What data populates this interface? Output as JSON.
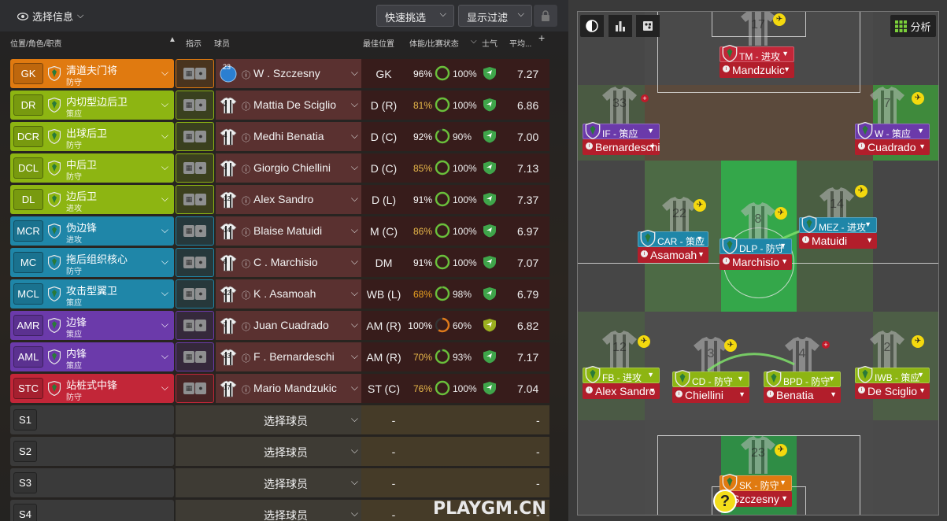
{
  "topbar": {
    "info_label": "选择信息",
    "quick_pick_label": "快速挑选",
    "filter_label": "显示过滤"
  },
  "columns": {
    "position": "位置/角色/职责",
    "instructions": "指示",
    "player": "球员",
    "best_position": "最佳位置",
    "condition": "体能/比赛状态",
    "morale": "士气",
    "average": "平均..."
  },
  "rows": [
    {
      "pos": "GK",
      "role": "清道夫门将",
      "duty": "防守",
      "color": "#e07a10",
      "player": "W . Szczesny",
      "shirt": "23",
      "best": "GK",
      "fitness": "96%",
      "fit_pct": 96,
      "fit_color": "#ffffff",
      "morale": "100%",
      "morale_pct": 100,
      "morale_color": "#6abf3a",
      "avg": "7.27"
    },
    {
      "pos": "DR",
      "role": "内切型边后卫",
      "duty": "策应",
      "color": "#8db512",
      "player": "Mattia De Sciglio",
      "shirt": "2",
      "best": "D (R)",
      "fitness": "81%",
      "fit_pct": 81,
      "fit_color": "#e8b84a",
      "morale": "100%",
      "morale_pct": 100,
      "morale_color": "#6abf3a",
      "avg": "6.86"
    },
    {
      "pos": "DCR",
      "role": "出球后卫",
      "duty": "防守",
      "color": "#8db512",
      "player": "Medhi Benatia",
      "shirt": "4",
      "best": "D (C)",
      "fitness": "92%",
      "fit_pct": 92,
      "fit_color": "#ffffff",
      "morale": "90%",
      "morale_pct": 90,
      "morale_color": "#6abf3a",
      "avg": "7.00"
    },
    {
      "pos": "DCL",
      "role": "中后卫",
      "duty": "防守",
      "color": "#8db512",
      "player": "Giorgio Chiellini",
      "shirt": "3",
      "best": "D (C)",
      "fitness": "85%",
      "fit_pct": 85,
      "fit_color": "#e8b84a",
      "morale": "100%",
      "morale_pct": 100,
      "morale_color": "#6abf3a",
      "avg": "7.13"
    },
    {
      "pos": "DL",
      "role": "边后卫",
      "duty": "进攻",
      "color": "#8db512",
      "player": "Alex Sandro",
      "shirt": "12",
      "best": "D (L)",
      "fitness": "91%",
      "fit_pct": 91,
      "fit_color": "#ffffff",
      "morale": "100%",
      "morale_pct": 100,
      "morale_color": "#6abf3a",
      "avg": "7.37"
    },
    {
      "pos": "MCR",
      "role": "伪边锋",
      "duty": "进攻",
      "color": "#1f86a8",
      "player": "Blaise Matuidi",
      "shirt": "14",
      "best": "M (C)",
      "fitness": "86%",
      "fit_pct": 86,
      "fit_color": "#e8b84a",
      "morale": "100%",
      "morale_pct": 100,
      "morale_color": "#6abf3a",
      "avg": "6.97"
    },
    {
      "pos": "MC",
      "role": "拖后组织核心",
      "duty": "防守",
      "color": "#1f86a8",
      "player": "C . Marchisio",
      "shirt": "8",
      "best": "DM",
      "fitness": "91%",
      "fit_pct": 91,
      "fit_color": "#ffffff",
      "morale": "100%",
      "morale_pct": 100,
      "morale_color": "#6abf3a",
      "avg": "7.07"
    },
    {
      "pos": "MCL",
      "role": "攻击型翼卫",
      "duty": "策应",
      "color": "#1f86a8",
      "player": "K . Asamoah",
      "shirt": "22",
      "best": "WB (L)",
      "fitness": "68%",
      "fit_pct": 68,
      "fit_color": "#e8a020",
      "morale": "98%",
      "morale_pct": 98,
      "morale_color": "#6abf3a",
      "avg": "6.79"
    },
    {
      "pos": "AMR",
      "role": "边锋",
      "duty": "策应",
      "color": "#6b3aaa",
      "player": "Juan Cuadrado",
      "shirt": "7",
      "best": "AM (R)",
      "fitness": "100%",
      "fit_pct": 100,
      "fit_color": "#ffffff",
      "morale": "60%",
      "morale_pct": 60,
      "morale_color": "#e07a1a",
      "avg": "6.82"
    },
    {
      "pos": "AML",
      "role": "内锋",
      "duty": "策应",
      "color": "#6b3aaa",
      "player": "F . Bernardeschi",
      "shirt": "33",
      "best": "AM (R)",
      "fitness": "70%",
      "fit_pct": 70,
      "fit_color": "#e8b84a",
      "morale": "93%",
      "morale_pct": 93,
      "morale_color": "#6abf3a",
      "avg": "7.17"
    },
    {
      "pos": "STC",
      "role": "站桩式中锋",
      "duty": "防守",
      "color": "#c22638",
      "player": "Mario Mandzukic",
      "shirt": "17",
      "best": "ST (C)",
      "fitness": "76%",
      "fit_pct": 76,
      "fit_color": "#e8b84a",
      "morale": "100%",
      "morale_pct": 100,
      "morale_color": "#6abf3a",
      "avg": "7.04"
    }
  ],
  "subs": [
    {
      "slot": "S1",
      "player": "选择球员",
      "best": "-",
      "avg": "-"
    },
    {
      "slot": "S2",
      "player": "选择球员",
      "best": "-",
      "avg": "-"
    },
    {
      "slot": "S3",
      "player": "选择球员",
      "best": "-",
      "avg": "-"
    },
    {
      "slot": "S4",
      "player": "选择球员",
      "best": "-",
      "avg": "-"
    }
  ],
  "pitch": {
    "analysis_label": "分析",
    "cards": [
      {
        "role": "TM - 进攻",
        "name": "Mandzukic",
        "role_color": "#c22638",
        "shirt": "17"
      },
      {
        "role": "IF - 策应",
        "name": "Bernardeschi",
        "role_color": "#6b3aaa",
        "shirt": "33"
      },
      {
        "role": "W - 策应",
        "name": "Cuadrado",
        "role_color": "#6b3aaa",
        "shirt": "7"
      },
      {
        "role": "CAR - 策应",
        "name": "Asamoah",
        "role_color": "#1f86a8",
        "shirt": "22"
      },
      {
        "role": "DLP - 防守",
        "name": "Marchisio",
        "role_color": "#1f86a8",
        "shirt": "8"
      },
      {
        "role": "MEZ - 进攻",
        "name": "Matuidi",
        "role_color": "#1f86a8",
        "shirt": "14"
      },
      {
        "role": "FB - 进攻",
        "name": "Alex Sandro",
        "role_color": "#8db512",
        "shirt": "12"
      },
      {
        "role": "CD - 防守",
        "name": "Chiellini",
        "role_color": "#8db512",
        "shirt": "3"
      },
      {
        "role": "BPD - 防守",
        "name": "Benatia",
        "role_color": "#8db512",
        "shirt": "4"
      },
      {
        "role": "IWB - 策应",
        "name": "De Sciglio",
        "role_color": "#8db512",
        "shirt": "2"
      },
      {
        "role": "SK - 防守",
        "name": "Szczesny",
        "role_color": "#e07a10",
        "shirt": "23"
      }
    ],
    "help": "?"
  },
  "watermark": "PLAYGM.CN"
}
